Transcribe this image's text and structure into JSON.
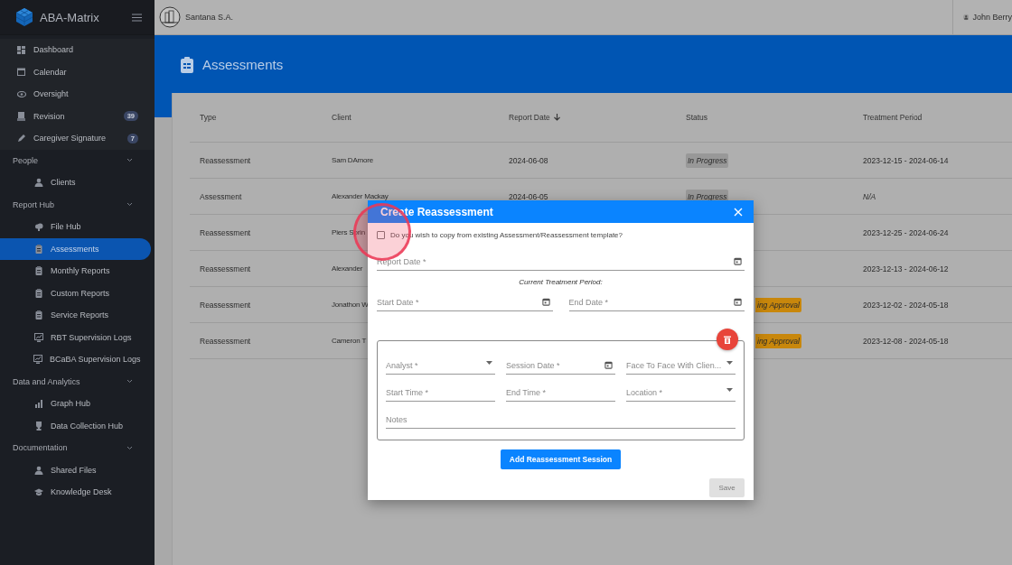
{
  "app": {
    "logo": "ABA-Matrix",
    "company": "Santana S.A.",
    "user": "John Berry"
  },
  "sidebar": {
    "items": [
      {
        "kind": "link",
        "label": "Dashboard",
        "selected": false
      },
      {
        "kind": "link",
        "label": "Calendar",
        "selected": false
      },
      {
        "kind": "link",
        "label": "Oversight",
        "selected": false
      },
      {
        "kind": "link",
        "label": "Revision",
        "badge": "39",
        "selected": false
      },
      {
        "kind": "link",
        "label": "Caregiver Signature",
        "badge": "7",
        "selected": false
      },
      {
        "kind": "section",
        "label": "People",
        "expanded": true,
        "children": [
          {
            "label": "Clients",
            "selected": false
          }
        ]
      },
      {
        "kind": "section",
        "label": "Report Hub",
        "expanded": true,
        "children": [
          {
            "label": "File Hub",
            "selected": false
          },
          {
            "label": "Assessments",
            "selected": true
          },
          {
            "label": "Monthly Reports",
            "selected": false
          },
          {
            "label": "Custom Reports",
            "selected": false
          },
          {
            "label": "Service Reports",
            "selected": false
          },
          {
            "label": "RBT Supervision Logs",
            "selected": false
          },
          {
            "label": "BCaBA Supervision Logs",
            "selected": false
          }
        ]
      },
      {
        "kind": "section",
        "label": "Data and Analytics",
        "expanded": true,
        "children": [
          {
            "label": "Graph Hub",
            "selected": false
          },
          {
            "label": "Data Collection Hub",
            "selected": false
          }
        ]
      },
      {
        "kind": "section",
        "label": "Documentation",
        "expanded": true,
        "children": [
          {
            "label": "Shared Files",
            "selected": false
          },
          {
            "label": "Knowledge Desk",
            "selected": false
          }
        ]
      }
    ]
  },
  "page": {
    "title": "Assessments"
  },
  "table": {
    "columns": [
      {
        "label": "Type",
        "sorted": false
      },
      {
        "label": "Client",
        "sorted": false
      },
      {
        "label": "Report Date",
        "sorted": true
      },
      {
        "label": "Status",
        "sorted": false
      },
      {
        "label": "Treatment Period",
        "sorted": false
      }
    ],
    "rows": [
      {
        "type": "Reassessment",
        "client": "Sam DAmore",
        "report_date": "2024-06-08",
        "status": {
          "text": "In Progress",
          "kind": "in_progress"
        },
        "treatment_period": "2023-12-15 - 2024-06-14",
        "period_missing": false
      },
      {
        "type": "Assessment",
        "client": "Alexander Mackay",
        "report_date": "2024-06-05",
        "status": {
          "text": "In Progress",
          "kind": "in_progress"
        },
        "treatment_period": "N/A",
        "period_missing": true
      },
      {
        "type": "Reassessment",
        "client": "Piers Sprin",
        "treatment_period": "2023-12-25 - 2024-06-24",
        "period_missing": false
      },
      {
        "type": "Reassessment",
        "client": "Alexander",
        "treatment_period": "2023-12-13 - 2024-06-12",
        "period_missing": false
      },
      {
        "type": "Reassessment",
        "client": "Jonathon W",
        "status": {
          "text": "ing Approval",
          "kind": "pending"
        },
        "treatment_period": "2023-12-02 - 2024-05-18",
        "period_missing": false
      },
      {
        "type": "Reassessment",
        "client": "Cameron T",
        "status": {
          "text": "ing Approval",
          "kind": "pending"
        },
        "treatment_period": "2023-12-08 - 2024-05-18",
        "period_missing": false
      }
    ]
  },
  "dialog": {
    "title": "Create Reassessment",
    "copy_checkbox": {
      "label": "Do you wish to copy from existing Assessment/Reassessment template?",
      "checked": false
    },
    "report_date": {
      "placeholder": "Report Date *",
      "kind": "date"
    },
    "period_label": "Current Treatment Period:",
    "period_fields": [
      {
        "placeholder": "Start Date *",
        "kind": "date"
      },
      {
        "placeholder": "End Date *",
        "kind": "date"
      }
    ],
    "session": {
      "fields": [
        {
          "placeholder": "Analyst *",
          "kind": "select"
        },
        {
          "placeholder": "Session Date *",
          "kind": "date"
        },
        {
          "placeholder": "Face To Face With Clien...",
          "kind": "select"
        },
        {
          "placeholder": "Start Time *",
          "kind": "text"
        },
        {
          "placeholder": "End Time *",
          "kind": "text"
        },
        {
          "placeholder": "Location *",
          "kind": "select"
        },
        {
          "placeholder": "Notes",
          "kind": "wide"
        }
      ]
    },
    "add_button": "Add Reassessment Session",
    "save_button": {
      "label": "Save",
      "disabled": true
    }
  }
}
